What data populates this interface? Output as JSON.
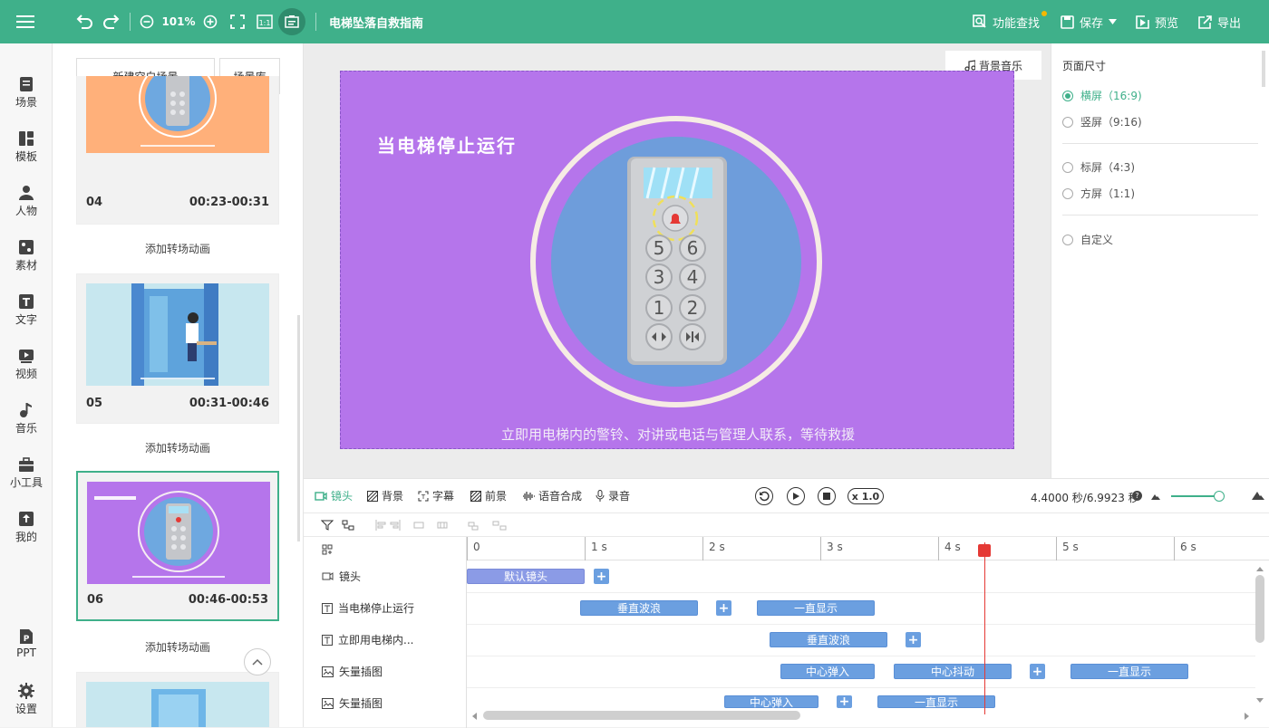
{
  "toolbar": {
    "zoom": "101%",
    "doc_title": "电梯坠落自救指南",
    "feature_search": "功能查找",
    "save": "保存",
    "preview": "预览",
    "export": "导出"
  },
  "rail": {
    "items": [
      "场景",
      "模板",
      "人物",
      "素材",
      "文字",
      "视频",
      "音乐",
      "小工具",
      "我的",
      "PPT",
      "设置"
    ]
  },
  "scene_panel": {
    "new_blank": "新建空白场景",
    "library": "场景库",
    "transition": "添加转场动画",
    "cards": [
      {
        "num": "04",
        "time": "00:23-00:31"
      },
      {
        "num": "05",
        "time": "00:31-00:46"
      },
      {
        "num": "06",
        "time": "00:46-00:53"
      }
    ]
  },
  "stage": {
    "headline": "当电梯停止运行",
    "subtitle": "立即用电梯内的警铃、对讲或电话与管理人联系，等待救援",
    "bgm": "背景音乐",
    "buttons": [
      "5",
      "6",
      "3",
      "4",
      "1",
      "2"
    ]
  },
  "page_size": {
    "title": "页面尺寸",
    "options": [
      {
        "label": "横屏（16:9)",
        "selected": true
      },
      {
        "label": "竖屏（9:16)",
        "selected": false
      },
      {
        "label": "标屏（4:3)",
        "selected": false
      },
      {
        "label": "方屏（1:1)",
        "selected": false
      },
      {
        "label": "自定义",
        "selected": false
      }
    ]
  },
  "timeline": {
    "tabs": [
      "镜头",
      "背景",
      "字幕",
      "前景",
      "语音合成",
      "录音"
    ],
    "speed": "x 1.0",
    "time_readout": "4.4000 秒/6.9923 秒",
    "ticks": [
      "0",
      "1 s",
      "2 s",
      "3 s",
      "4 s",
      "5 s",
      "6 s"
    ],
    "tracks": [
      {
        "label": "镜头",
        "clips": [
          "默认镜头"
        ]
      },
      {
        "label": "当电梯停止运行",
        "clips": [
          "垂直波浪",
          "一直显示"
        ]
      },
      {
        "label": "立即用电梯内...",
        "clips": [
          "垂直波浪"
        ]
      },
      {
        "label": "矢量插图",
        "clips": [
          "中心弹入",
          "中心抖动",
          "一直显示"
        ]
      },
      {
        "label": "矢量插图",
        "clips": [
          "中心弹入",
          "一直显示"
        ]
      }
    ]
  },
  "colors": {
    "brand": "#3fb08a",
    "stage_bg": "#b575eb",
    "clip": "#6b9fe0",
    "playhead": "#e53935"
  }
}
